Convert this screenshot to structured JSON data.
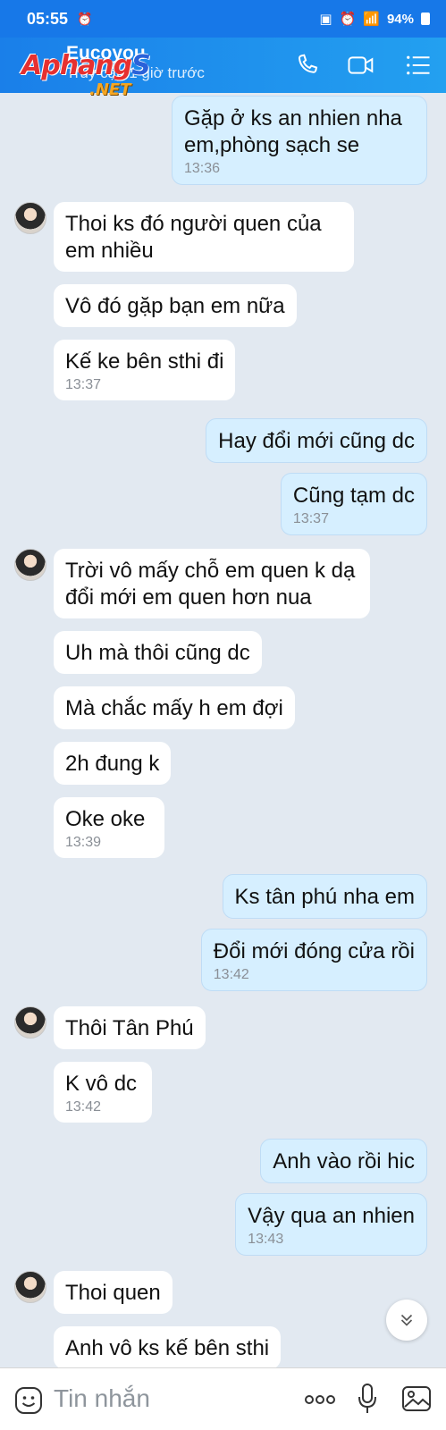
{
  "status_bar": {
    "time": "05:55",
    "battery": "94%"
  },
  "header": {
    "contact_name": "Eucoyou",
    "last_seen": "Truy cập 1 giờ trước",
    "watermark_main_red": "Aphang",
    "watermark_main_blue": "S",
    "watermark_net": ".NET"
  },
  "messages": [
    {
      "side": "out",
      "text": "Gặp ở ks an nhien nha em,phòng sạch se",
      "time": "13:36"
    },
    {
      "side": "in",
      "text": "Thoi ks đó người quen của em nhiều",
      "avatar": true
    },
    {
      "side": "in",
      "text": "Vô đó gặp bạn em nữa"
    },
    {
      "side": "in",
      "text": "Kế ke bên sthi đi",
      "time": "13:37"
    },
    {
      "side": "out",
      "text": "Hay đổi mới cũng dc"
    },
    {
      "side": "out",
      "text": "Cũng tạm dc",
      "time": "13:37"
    },
    {
      "side": "in",
      "text": "Trời vô mấy chỗ em quen k dạ đổi mới em quen hơn nua",
      "avatar": true
    },
    {
      "side": "in",
      "text": "Uh mà thôi cũng dc"
    },
    {
      "side": "in",
      "text": "Mà chắc mấy h em đợi"
    },
    {
      "side": "in",
      "text": "2h đung k"
    },
    {
      "side": "in",
      "text": "Oke oke",
      "time": "13:39"
    },
    {
      "side": "out",
      "text": "Ks tân phú nha em"
    },
    {
      "side": "out",
      "text": "Đổi mới đóng cửa rồi",
      "time": "13:42"
    },
    {
      "side": "in",
      "text": "Thôi Tân Phú",
      "avatar": true
    },
    {
      "side": "in",
      "text": "K vô dc",
      "time": "13:42"
    },
    {
      "side": "out",
      "text": "Anh vào rồi hic"
    },
    {
      "side": "out",
      "text": "Vậy qua an nhien",
      "time": "13:43"
    },
    {
      "side": "in",
      "text": "Thoi quen",
      "avatar": true
    },
    {
      "side": "in",
      "text": "Anh vô ks kế bên sthi"
    }
  ],
  "composer": {
    "placeholder": "Tin nhắn"
  },
  "colors": {
    "header": "#1a7fe9",
    "incoming_bubble": "#ffffff",
    "outgoing_bubble": "#d6efff",
    "background": "#e2e9f1"
  },
  "icons": [
    "phone-icon",
    "video-call-icon",
    "menu-list-icon",
    "emoji-icon",
    "more-icon",
    "microphone-icon",
    "image-icon",
    "scroll-down-icon"
  ]
}
